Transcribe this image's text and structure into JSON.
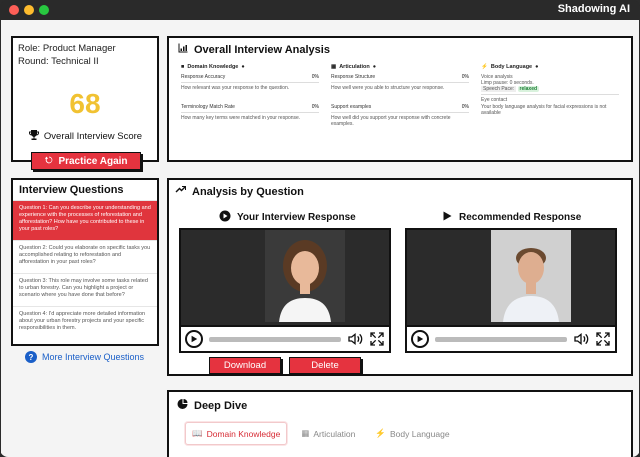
{
  "window": {
    "title": "Shadowing AI"
  },
  "score_card": {
    "role": "Role: Product Manager",
    "round": "Round: Technical II",
    "score": "68",
    "score_label": "Overall Interview Score",
    "practice_button": "Practice Again"
  },
  "overall": {
    "title": "Overall Interview Analysis",
    "domain": {
      "heading": "Domain Knowledge",
      "m1_label": "Response Accuracy",
      "m1_value": "0%",
      "m1_desc": "How relevant was your response to the question.",
      "m2_label": "Terminology Match Rate",
      "m2_value": "0%",
      "m2_desc": "How many key terms were matched in your response."
    },
    "articulation": {
      "heading": "Articulation",
      "m1_label": "Response Structure",
      "m1_value": "0%",
      "m1_desc": "How well were you able to structure your response.",
      "m2_label": "Support examples",
      "m2_value": "0%",
      "m2_desc": "How well did you support your response with concrete examples."
    },
    "body": {
      "heading": "Body Language",
      "voice": "Voice analysis",
      "line_label": "Limp pause:",
      "line_value": "0 seconds.",
      "pace_label": "Speech Pace:",
      "pace_value": "relaxed",
      "eye": "Eye contact",
      "eye_desc": "Your body language analysis for facial expressions is not available"
    }
  },
  "questions": {
    "title": "Interview Questions",
    "items": [
      "Question 1: Can you describe your understanding and experience with the processes of reforestation and afforestation? How have you contributed to these in your past roles?",
      "Question 2: Could you elaborate on specific tasks you accomplished relating to reforestation and afforestation in your past roles?",
      "Question 3: This role may involve some tasks related to urban forestry. Can you highlight a project or scenario where you have done that before?",
      "Question 4: I'd appreciate more detailed information about your urban forestry projects and your specific responsibilities in them."
    ],
    "more": "More Interview Questions"
  },
  "analysis": {
    "title": "Analysis by Question",
    "your_response": "Your Interview Response",
    "recommended": "Recommended Response",
    "download": "Download",
    "delete": "Delete"
  },
  "deep_dive": {
    "title": "Deep Dive",
    "tabs": [
      "Domain Knowledge",
      "Articulation",
      "Body Language"
    ]
  },
  "colors": {
    "accent": "#e5333f",
    "score": "#f1c232",
    "link": "#1a5fc8"
  }
}
